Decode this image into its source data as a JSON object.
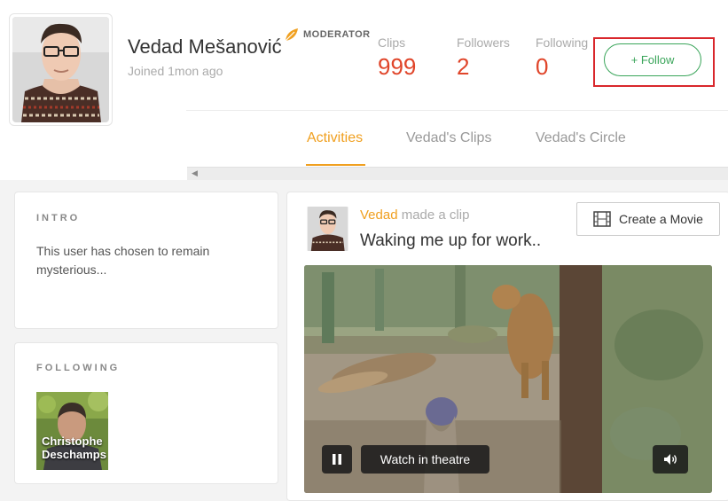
{
  "profile": {
    "name": "Vedad Mešanović",
    "badge": "MODERATOR",
    "joined": "Joined 1mon ago"
  },
  "stats": [
    {
      "label": "Clips",
      "value": "999"
    },
    {
      "label": "Followers",
      "value": "2"
    },
    {
      "label": "Following",
      "value": "0"
    }
  ],
  "follow_button": {
    "label": "+ Follow"
  },
  "tabs": [
    {
      "label": "Activities",
      "active": true
    },
    {
      "label": "Vedad's Clips",
      "active": false
    },
    {
      "label": "Vedad's Circle",
      "active": false
    }
  ],
  "intro": {
    "heading": "INTRO",
    "text": "This user has chosen to remain mysterious..."
  },
  "following": {
    "heading": "FOLLOWING",
    "users": [
      {
        "name_line1": "Christophe",
        "name_line2": "Deschamps"
      }
    ]
  },
  "feed": {
    "user": "Vedad",
    "verb": "made a clip",
    "title": "Waking me up for work..",
    "create_movie_label": "Create a Movie",
    "video": {
      "theatre_label": "Watch in theatre",
      "state": "playing"
    }
  },
  "colors": {
    "accent": "#f0a020",
    "stat_value": "#e0452a",
    "follow_green": "#3aa55a",
    "highlight_red": "#d9272c"
  },
  "icons": [
    "moderator-leaf-icon",
    "film-icon",
    "pause-icon",
    "volume-icon",
    "scroll-left-arrow-icon"
  ]
}
